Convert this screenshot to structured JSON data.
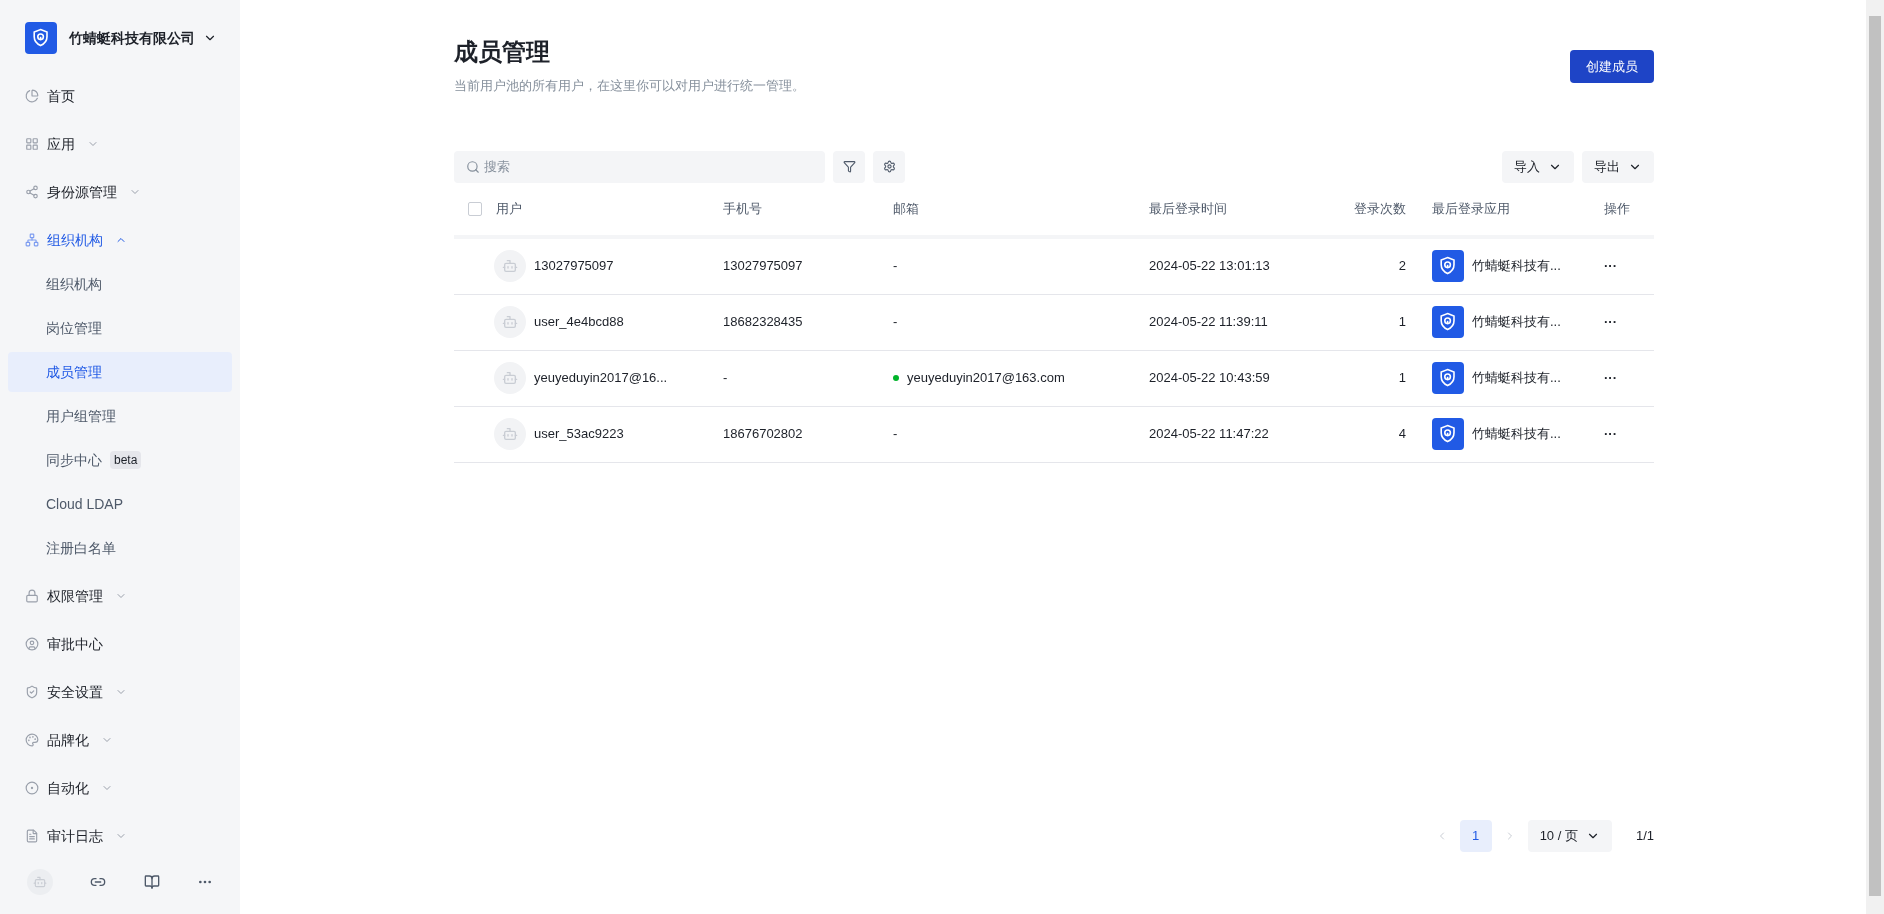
{
  "sidebar": {
    "org_name": "竹蜻蜓科技有限公司",
    "items": [
      {
        "label": "首页",
        "kind": "link",
        "selected": false
      },
      {
        "label": "应用",
        "kind": "group",
        "expanded": false
      },
      {
        "label": "身份源管理",
        "kind": "group",
        "expanded": false
      },
      {
        "label": "组织机构",
        "kind": "group",
        "expanded": true,
        "children": [
          {
            "label": "组织机构",
            "selected": false
          },
          {
            "label": "岗位管理",
            "selected": false
          },
          {
            "label": "成员管理",
            "selected": true
          },
          {
            "label": "用户组管理",
            "selected": false
          },
          {
            "label": "同步中心",
            "badge": "beta",
            "selected": false
          },
          {
            "label": "Cloud LDAP",
            "selected": false
          },
          {
            "label": "注册白名单",
            "selected": false
          }
        ]
      },
      {
        "label": "权限管理",
        "kind": "group",
        "expanded": false
      },
      {
        "label": "审批中心",
        "kind": "link",
        "selected": false
      },
      {
        "label": "安全设置",
        "kind": "group",
        "expanded": false
      },
      {
        "label": "品牌化",
        "kind": "group",
        "expanded": false
      },
      {
        "label": "自动化",
        "kind": "group",
        "expanded": false
      },
      {
        "label": "审计日志",
        "kind": "group",
        "expanded": false
      }
    ]
  },
  "page": {
    "title": "成员管理",
    "subtitle": "当前用户池的所有用户，在这里你可以对用户进行统一管理。",
    "create_button": "创建成员"
  },
  "toolbar": {
    "search_placeholder": "搜索",
    "import_button": "导入",
    "export_button": "导出"
  },
  "table": {
    "columns": [
      "用户",
      "手机号",
      "邮箱",
      "最后登录时间",
      "登录次数",
      "最后登录应用",
      "操作"
    ],
    "all_checked": false,
    "rows": [
      {
        "user": "13027975097",
        "phone": "13027975097",
        "email": "-",
        "email_verified": false,
        "last_login": "2024-05-22 13:01:13",
        "login_count": "2",
        "app": "竹蜻蜓科技有...",
        "action": "···"
      },
      {
        "user": "user_4e4bcd88",
        "phone": "18682328435",
        "email": "-",
        "email_verified": false,
        "last_login": "2024-05-22 11:39:11",
        "login_count": "1",
        "app": "竹蜻蜓科技有...",
        "action": "···"
      },
      {
        "user": "yeuyeduyin2017@16...",
        "phone": "-",
        "email": "yeuyeduyin2017@163.com",
        "email_verified": true,
        "last_login": "2024-05-22 10:43:59",
        "login_count": "1",
        "app": "竹蜻蜓科技有...",
        "action": "···"
      },
      {
        "user": "user_53ac9223",
        "phone": "18676702802",
        "email": "-",
        "email_verified": false,
        "last_login": "2024-05-22 11:47:22",
        "login_count": "4",
        "app": "竹蜻蜓科技有...",
        "action": "···"
      }
    ]
  },
  "pagination": {
    "pages": [
      {
        "label": "1",
        "selected": true
      }
    ],
    "page_size": "10 / 页",
    "summary": "1/1"
  }
}
